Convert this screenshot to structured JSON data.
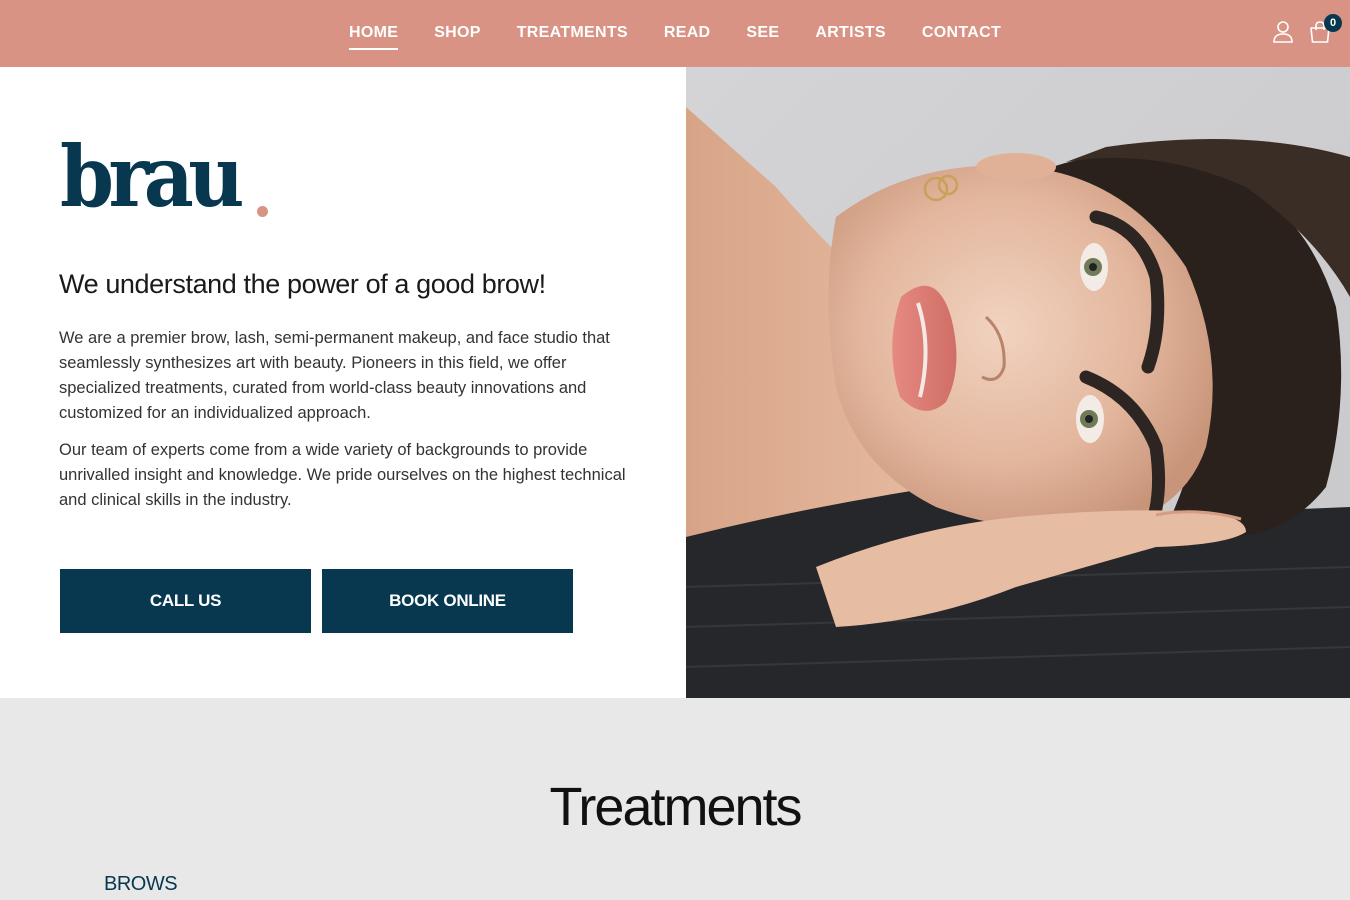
{
  "nav": {
    "links": [
      {
        "label": "HOME",
        "active": true
      },
      {
        "label": "SHOP",
        "active": false
      },
      {
        "label": "TREATMENTS",
        "active": false
      },
      {
        "label": "READ",
        "active": false
      },
      {
        "label": "SEE",
        "active": false
      },
      {
        "label": "ARTISTS",
        "active": false
      },
      {
        "label": "CONTACT",
        "active": false
      }
    ],
    "account_icon": "user-icon",
    "cart_icon": "shopping-bag-icon",
    "cart_count": "0"
  },
  "hero": {
    "logo_text": "brau",
    "heading": "We understand the power of a good brow!",
    "paragraph_1": "We are a premier brow, lash, semi-permanent makeup, and face studio that seamlessly synthesizes art with beauty. Pioneers in this field, we offer specialized treatments, curated from world-class beauty innovations and customized for an individualized approach.",
    "paragraph_2": "Our team of experts come from a wide variety of backgrounds to provide unrivalled insight and knowledge. We pride ourselves on the highest technical and clinical skills in the industry.",
    "call_button": "CALL US",
    "book_button": "BOOK ONLINE"
  },
  "treatments": {
    "title": "Treatments",
    "first_category": "BROWS"
  },
  "colors": {
    "nav_bg": "#d99384",
    "brand_navy": "#073850",
    "accent_pink": "#d99384",
    "section_bg": "#e8e8e8"
  }
}
